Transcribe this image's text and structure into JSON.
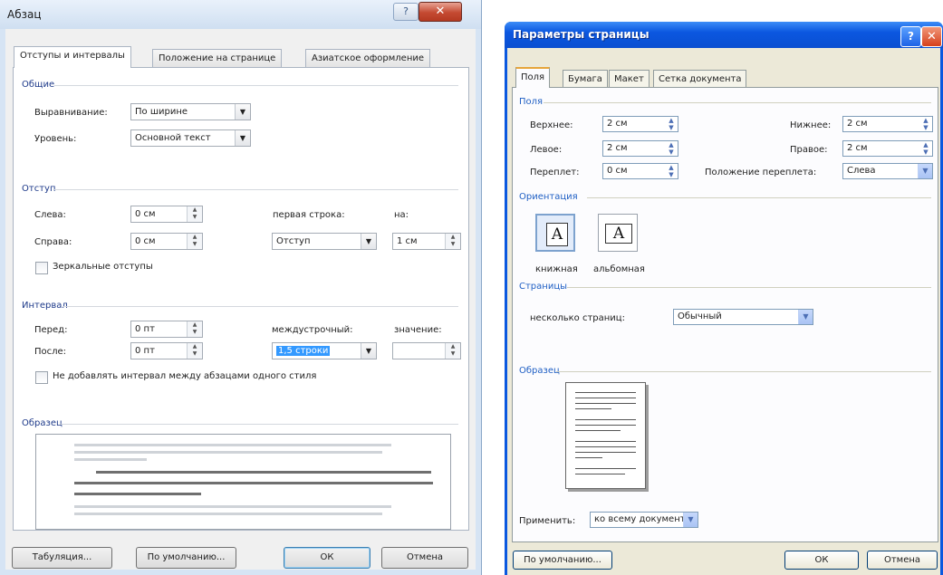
{
  "paragraph_dialog": {
    "title": "Абзац",
    "tabs": [
      {
        "label": "Отступы и интервалы",
        "active": true
      },
      {
        "label": "Положение на странице",
        "active": false
      },
      {
        "label": "Азиатское оформление",
        "active": false
      }
    ],
    "general": {
      "heading": "Общие",
      "alignment_label": "Выравнивание:",
      "alignment_value": "По ширине",
      "level_label": "Уровень:",
      "level_value": "Основной текст"
    },
    "indent": {
      "heading": "Отступ",
      "left_label": "Слева:",
      "left_value": "0 см",
      "right_label": "Справа:",
      "right_value": "0 см",
      "first_line_label": "первая строка:",
      "first_line_value": "Отступ",
      "by_label": "на:",
      "by_value": "1 см",
      "mirror_label": "Зеркальные отступы"
    },
    "spacing": {
      "heading": "Интервал",
      "before_label": "Перед:",
      "before_value": "0 пт",
      "after_label": "После:",
      "after_value": "0 пт",
      "line_spacing_label": "междустрочный:",
      "line_spacing_value": "1,5 строки",
      "value_label": "значение:",
      "value_value": "",
      "dont_add_label": "Не добавлять интервал между абзацами одного стиля"
    },
    "sample_heading": "Образец",
    "buttons": {
      "tabs": "Табуляция...",
      "default": "По умолчанию...",
      "ok": "ОК",
      "cancel": "Отмена"
    }
  },
  "page_setup_dialog": {
    "title": "Параметры страницы",
    "tabs": [
      {
        "label": "Поля",
        "active": true
      },
      {
        "label": "Бумага",
        "active": false
      },
      {
        "label": "Макет",
        "active": false
      },
      {
        "label": "Сетка документа",
        "active": false
      }
    ],
    "margins": {
      "heading": "Поля",
      "top_label": "Верхнее:",
      "top_value": "2 см",
      "bottom_label": "Нижнее:",
      "bottom_value": "2 см",
      "left_label": "Левое:",
      "left_value": "2 см",
      "right_label": "Правое:",
      "right_value": "2 см",
      "gutter_label": "Переплет:",
      "gutter_value": "0 см",
      "gutter_pos_label": "Положение переплета:",
      "gutter_pos_value": "Слева"
    },
    "orientation": {
      "heading": "Ориентация",
      "portrait_label": "книжная",
      "landscape_label": "альбомная",
      "glyph": "A"
    },
    "pages": {
      "heading": "Страницы",
      "multiple_label": "несколько страниц:",
      "multiple_value": "Обычный"
    },
    "sample_heading": "Образец",
    "apply_label": "Применить:",
    "apply_value": "ко всему документу",
    "buttons": {
      "default": "По умолчанию...",
      "ok": "ОК",
      "cancel": "Отмена"
    }
  }
}
